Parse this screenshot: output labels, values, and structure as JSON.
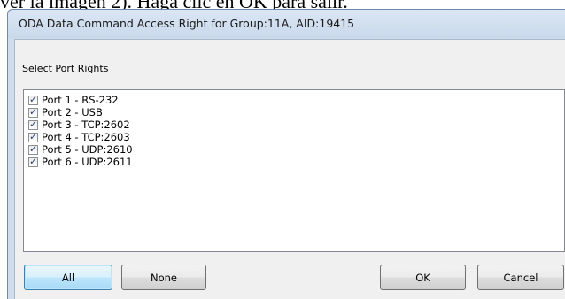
{
  "background_text": "ver la imagen 2). Haga clic en OK para salir.",
  "window": {
    "title": "ODA Data Command Access Right for Group:11A, AID:19415"
  },
  "group": {
    "label": "Select Port Rights"
  },
  "ports": [
    {
      "label": "Port 1 - RS-232",
      "checked": true
    },
    {
      "label": "Port 2 - USB",
      "checked": true
    },
    {
      "label": "Port 3 - TCP:2602",
      "checked": true
    },
    {
      "label": "Port 4 - TCP:2603",
      "checked": true
    },
    {
      "label": "Port 5 - UDP:2610",
      "checked": true
    },
    {
      "label": "Port 6 - UDP:2611",
      "checked": true
    }
  ],
  "buttons": {
    "all": "All",
    "none": "None",
    "ok": "OK",
    "cancel": "Cancel"
  }
}
